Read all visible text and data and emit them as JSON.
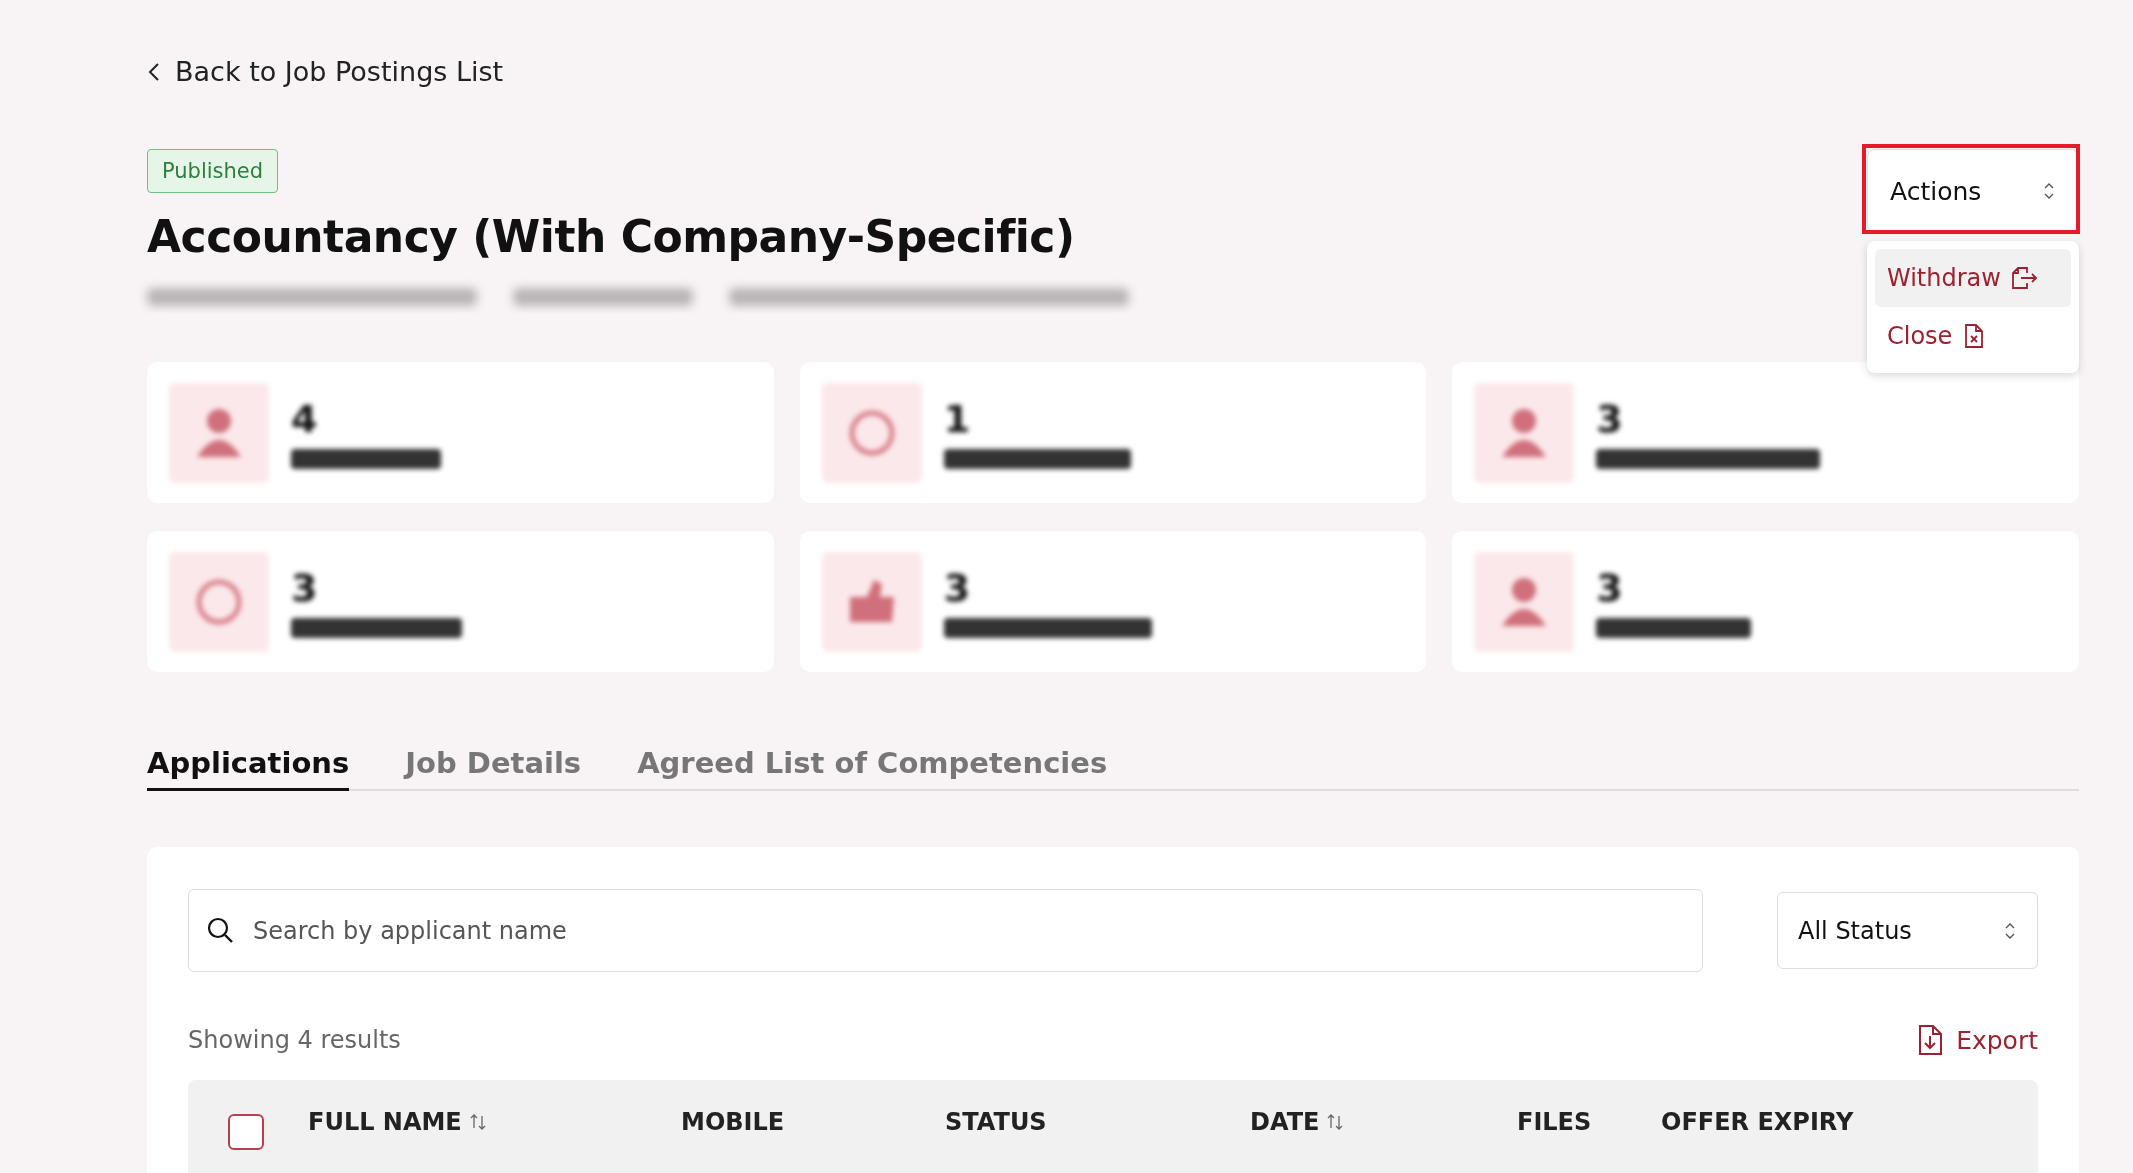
{
  "back_link": {
    "label": "Back to Job Postings List"
  },
  "status_badge": {
    "label": "Published",
    "kind": "published"
  },
  "title": "Accountancy (With Company-Specific)",
  "actions": {
    "label": "Actions",
    "expanded": true,
    "highlighted": true,
    "menu": [
      {
        "label": "Withdraw",
        "kind": "withdraw",
        "selected": true
      },
      {
        "label": "Close",
        "kind": "close",
        "selected": false
      }
    ]
  },
  "stats": [
    {
      "value": "4",
      "kind": "applicants"
    },
    {
      "value": "1",
      "kind": "pending"
    },
    {
      "value": "3",
      "kind": "shortlisted"
    },
    {
      "value": "3",
      "kind": "interview"
    },
    {
      "value": "3",
      "kind": "offer"
    },
    {
      "value": "3",
      "kind": "hired"
    }
  ],
  "tabs": [
    {
      "label": "Applications",
      "selected": true
    },
    {
      "label": "Job Details",
      "selected": false
    },
    {
      "label": "Agreed List of Competencies",
      "selected": false
    }
  ],
  "search": {
    "placeholder": "Search by applicant name"
  },
  "status_filter": {
    "value": "All Status"
  },
  "results": "Showing 4 results",
  "export": {
    "label": "Export"
  },
  "table": {
    "select_all": {
      "checked": false
    },
    "columns": [
      {
        "label": "FULL NAME",
        "sortable": true
      },
      {
        "label": "MOBILE",
        "sortable": false
      },
      {
        "label": "STATUS",
        "sortable": false
      },
      {
        "label": "DATE",
        "sortable": true
      },
      {
        "label": "FILES",
        "sortable": false
      },
      {
        "label": "OFFER EXPIRY",
        "sortable": false
      }
    ]
  }
}
